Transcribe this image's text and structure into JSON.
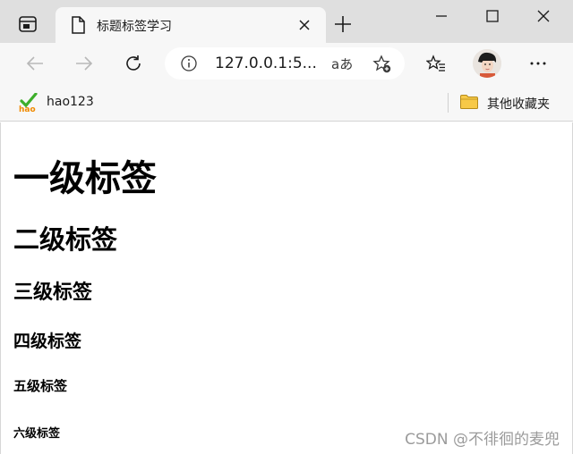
{
  "tab": {
    "title": "标题标签学习"
  },
  "address": {
    "url": "127.0.0.1:5...",
    "read_aloud": "aあ"
  },
  "favorites": {
    "item_label": "hao123",
    "item_logo": "hao",
    "folder_label": "其他收藏夹"
  },
  "page": {
    "h1": "一级标签",
    "h2": "二级标签",
    "h3": "三级标签",
    "h4": "四级标签",
    "h5": "五级标签",
    "h6": "六级标签",
    "watermark": "CSDN @不徘徊的麦兜"
  },
  "icons": {
    "tab_actions": "tab-actions-icon",
    "page": "page-icon",
    "close": "close-icon",
    "new_tab": "plus-icon",
    "minimize": "minimize-icon",
    "maximize": "maximize-icon",
    "window_close": "window-close-icon",
    "back": "back-arrow-icon",
    "forward": "forward-arrow-icon",
    "refresh": "refresh-icon",
    "info": "info-icon",
    "add_favorite": "add-favorite-icon",
    "favorites": "favorites-icon",
    "more": "more-icon",
    "folder": "folder-icon"
  },
  "colors": {
    "chrome": "#dfdfdf",
    "toolbar": "#f7f7f7",
    "folder": "#f7c948",
    "hao_green": "#3dae2b",
    "hao_orange": "#f08a00"
  }
}
